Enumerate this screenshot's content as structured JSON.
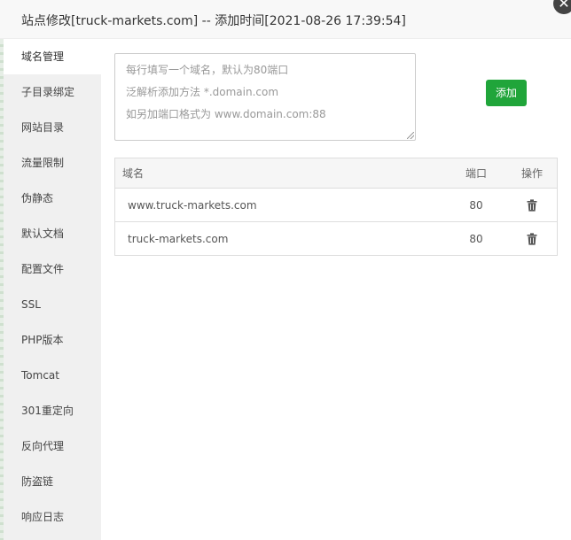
{
  "dialog": {
    "title": "站点修改[truck-markets.com] -- 添加时间[2021-08-26 17:39:54]",
    "close_icon": "close-icon"
  },
  "sidebar": {
    "items": [
      {
        "label": "域名管理",
        "active": true
      },
      {
        "label": "子目录绑定"
      },
      {
        "label": "网站目录"
      },
      {
        "label": "流量限制"
      },
      {
        "label": "伪静态"
      },
      {
        "label": "默认文档"
      },
      {
        "label": "配置文件"
      },
      {
        "label": "SSL"
      },
      {
        "label": "PHP版本"
      },
      {
        "label": "Tomcat"
      },
      {
        "label": "301重定向"
      },
      {
        "label": "反向代理"
      },
      {
        "label": "防盗链"
      },
      {
        "label": "响应日志"
      }
    ]
  },
  "domain_input": {
    "placeholder_lines": [
      "每行填写一个域名，默认为80端口",
      "泛解析添加方法 *.domain.com",
      "如另加端口格式为 www.domain.com:88"
    ],
    "value": ""
  },
  "add_button": {
    "label": "添加",
    "color": "#20a53a"
  },
  "table": {
    "headers": {
      "domain": "域名",
      "port": "端口",
      "op": "操作"
    },
    "rows": [
      {
        "domain": "www.truck-markets.com",
        "port": "80",
        "op_icon": "trash-icon"
      },
      {
        "domain": "truck-markets.com",
        "port": "80",
        "op_icon": "trash-icon"
      }
    ]
  }
}
